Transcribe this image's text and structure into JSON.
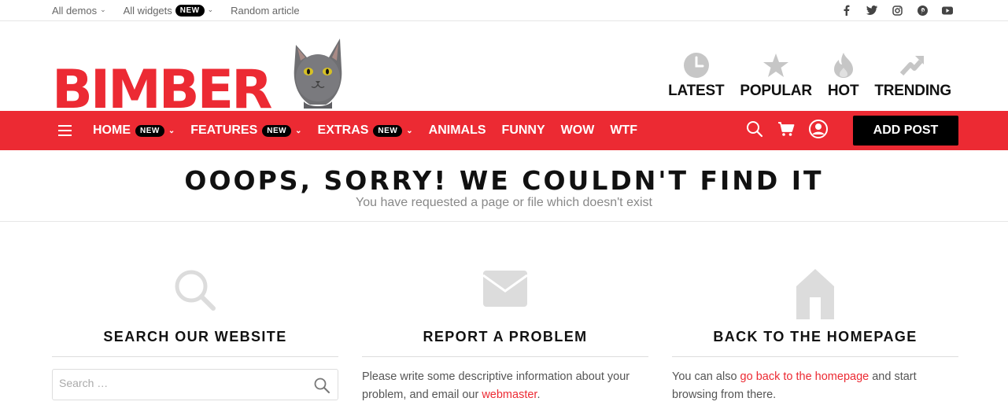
{
  "topbar": {
    "links": [
      {
        "label": "All demos",
        "has_chevron": true,
        "badge": ""
      },
      {
        "label": "All widgets",
        "has_chevron": true,
        "badge": "NEW"
      },
      {
        "label": "Random article",
        "has_chevron": false,
        "badge": ""
      }
    ],
    "social_icons": [
      "facebook-icon",
      "twitter-icon",
      "instagram-icon",
      "pinterest-icon",
      "youtube-icon"
    ]
  },
  "header": {
    "logo_text": "BIMBER",
    "quick_links": [
      {
        "label": "LATEST",
        "icon": "clock-icon"
      },
      {
        "label": "POPULAR",
        "icon": "star-icon"
      },
      {
        "label": "HOT",
        "icon": "flame-icon"
      },
      {
        "label": "TRENDING",
        "icon": "trending-arrow-icon"
      }
    ]
  },
  "nav": {
    "items": [
      {
        "label": "HOME",
        "badge": "NEW",
        "has_chevron": true
      },
      {
        "label": "FEATURES",
        "badge": "NEW",
        "has_chevron": true
      },
      {
        "label": "EXTRAS",
        "badge": "NEW",
        "has_chevron": true
      },
      {
        "label": "ANIMALS",
        "badge": "",
        "has_chevron": false
      },
      {
        "label": "FUNNY",
        "badge": "",
        "has_chevron": false
      },
      {
        "label": "WOW",
        "badge": "",
        "has_chevron": false
      },
      {
        "label": "WTF",
        "badge": "",
        "has_chevron": false
      }
    ],
    "add_post_label": "ADD POST"
  },
  "page": {
    "title": "OOOPS, SORRY! WE COULDN'T FIND IT",
    "subtitle": "You have requested a page or file which doesn't exist"
  },
  "columns": {
    "search": {
      "heading": "SEARCH OUR WEBSITE",
      "placeholder": "Search …"
    },
    "report": {
      "heading": "REPORT A PROBLEM",
      "text_before": "Please write some descriptive information about your problem, and email our ",
      "link": "webmaster",
      "text_after": "."
    },
    "home": {
      "heading": "BACK TO THE HOMEPAGE",
      "text_before": "You can also ",
      "link": "go back to the homepage",
      "text_after": " and start browsing from there."
    }
  },
  "colors": {
    "brand_red": "#ec2a33",
    "black": "#000000",
    "icon_gray": "#cfcfcf"
  }
}
